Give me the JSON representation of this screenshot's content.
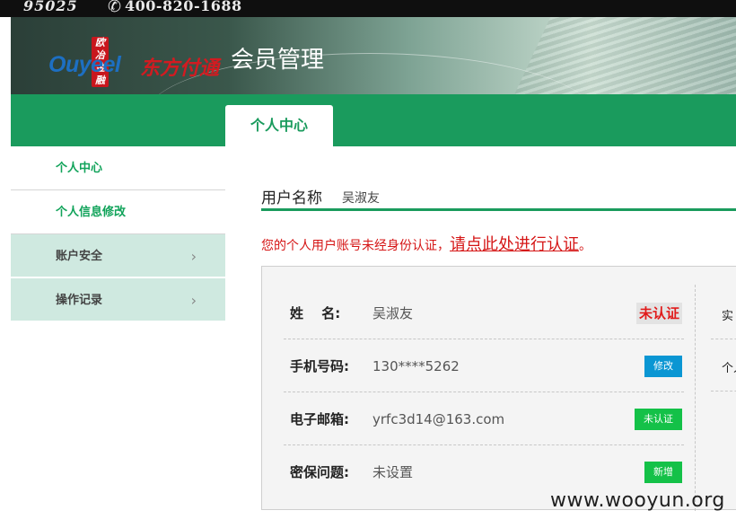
{
  "topbar": {
    "number": "95025",
    "phone_icon": "phone-icon",
    "phone": "400-820-1688"
  },
  "banner": {
    "logo_tag": "欧冶金融",
    "logo_en": "Ouyeel",
    "logo_cn": "东方付通",
    "system_title": "会员管理"
  },
  "nav": {
    "tab_label": "个人中心"
  },
  "sidebar": {
    "items": [
      {
        "label": "个人中心"
      },
      {
        "label": "个人信息修改"
      },
      {
        "label": "账户安全",
        "icon": "chevron-right-icon"
      },
      {
        "label": "操作记录",
        "icon": "chevron-right-icon"
      }
    ],
    "chevron": "›"
  },
  "main": {
    "username_label": "用户名称",
    "username_value": "吴淑友",
    "warning_text": "您的个人用户账号未经身份认证，",
    "warning_link": "请点此处进行认证",
    "warning_end": "。",
    "rows": [
      {
        "label": "姓　 名:",
        "value": "吴淑友",
        "status": "未认证"
      },
      {
        "label": "手机号码:",
        "value": "130****5262",
        "button": "修改"
      },
      {
        "label": "电子邮箱:",
        "value": "yrfc3d14@163.com",
        "button": "未认证"
      },
      {
        "label": "密保问题:",
        "value": "未设置",
        "button": "新增"
      }
    ],
    "right_col": [
      "实",
      "个人"
    ]
  },
  "watermark": "www.wooyun.org",
  "colors": {
    "brand_green": "#1a9b5d",
    "sidebar_mint": "#cfe9e0",
    "warning_red": "#d51515",
    "button_blue": "#0a96d3",
    "button_green": "#14c148"
  }
}
